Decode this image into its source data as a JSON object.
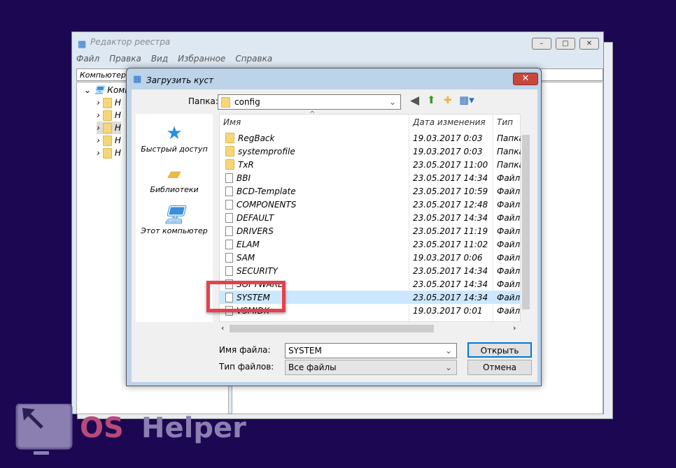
{
  "regedit": {
    "title": "Редактор реестра",
    "menu": [
      "Файл",
      "Правка",
      "Вид",
      "Избранное",
      "Справка"
    ],
    "address": "Компьютер",
    "tree_root": "Компьютер",
    "tree_items": [
      "H",
      "H",
      "H",
      "H",
      "H"
    ]
  },
  "dialog": {
    "title": "Загрузить куст",
    "close": "✕",
    "folder_label": "Папка:",
    "folder_value": "config",
    "places": [
      {
        "label": "Быстрый доступ",
        "icon": "star-icon"
      },
      {
        "label": "Библиотеки",
        "icon": "libraries-icon"
      },
      {
        "label": "Этот компьютер",
        "icon": "computer-icon"
      }
    ],
    "columns": [
      "Имя",
      "Дата изменения",
      "Тип"
    ],
    "files": [
      {
        "name": "RegBack",
        "date": "19.03.2017 0:03",
        "type": "Папка",
        "folder": true
      },
      {
        "name": "systemprofile",
        "date": "19.03.2017 0:03",
        "type": "Папка",
        "folder": true
      },
      {
        "name": "TxR",
        "date": "23.05.2017 11:00",
        "type": "Папка",
        "folder": true
      },
      {
        "name": "BBI",
        "date": "23.05.2017 14:34",
        "type": "Файл"
      },
      {
        "name": "BCD-Template",
        "date": "23.05.2017 10:59",
        "type": "Файл"
      },
      {
        "name": "COMPONENTS",
        "date": "23.05.2017 12:48",
        "type": "Файл"
      },
      {
        "name": "DEFAULT",
        "date": "23.05.2017 14:34",
        "type": "Файл"
      },
      {
        "name": "DRIVERS",
        "date": "23.05.2017 11:19",
        "type": "Файл"
      },
      {
        "name": "ELAM",
        "date": "23.05.2017 11:02",
        "type": "Файл"
      },
      {
        "name": "SAM",
        "date": "19.03.2017 0:06",
        "type": "Файл"
      },
      {
        "name": "SECURITY",
        "date": "23.05.2017 14:34",
        "type": "Файл"
      },
      {
        "name": "SOFTWARE",
        "date": "23.05.2017 14:34",
        "type": "Файл"
      },
      {
        "name": "SYSTEM",
        "date": "23.05.2017 14:34",
        "type": "Файл",
        "selected": true
      },
      {
        "name": "VSMIDK",
        "date": "19.03.2017 0:01",
        "type": "Файл"
      }
    ],
    "filename_label": "Имя файла:",
    "filename_value": "SYSTEM",
    "filetype_label": "Тип файлов:",
    "filetype_value": "Все файлы",
    "open": "Открыть",
    "cancel": "Отмена"
  },
  "watermark": "OS Helper",
  "colors": {
    "background": "#1b0752",
    "highlight": "#e8404a",
    "selection": "#cce8ff"
  }
}
